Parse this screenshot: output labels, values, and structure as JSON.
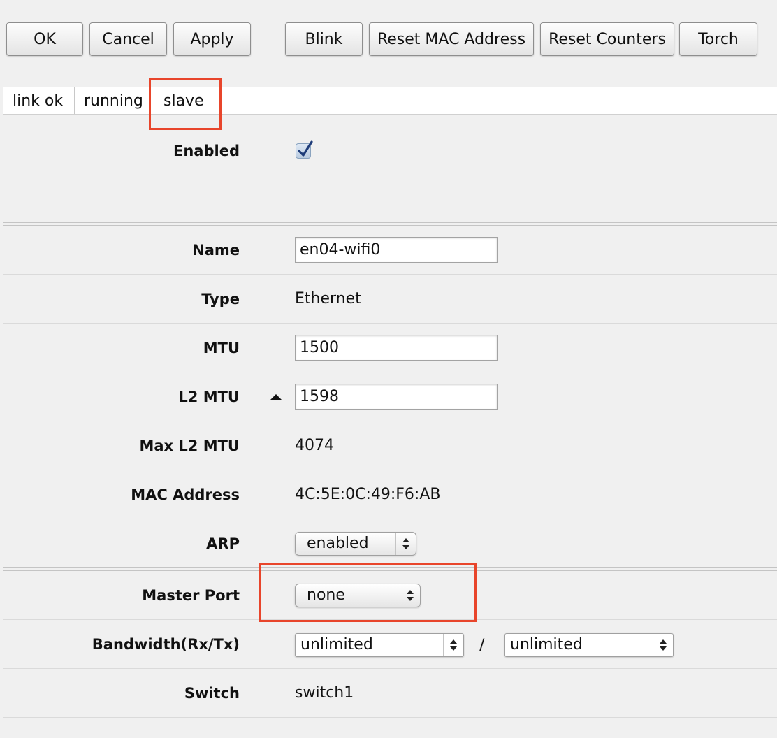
{
  "toolbar": {
    "ok": "OK",
    "cancel": "Cancel",
    "apply": "Apply",
    "blink": "Blink",
    "reset_mac": "Reset MAC Address",
    "reset_counters": "Reset Counters",
    "torch": "Torch"
  },
  "status_tabs": [
    "link ok",
    "running",
    "slave"
  ],
  "form": {
    "enabled": {
      "label": "Enabled",
      "checked": true
    },
    "name": {
      "label": "Name",
      "value": "en04-wifi0"
    },
    "type": {
      "label": "Type",
      "value": "Ethernet"
    },
    "mtu": {
      "label": "MTU",
      "value": "1500"
    },
    "l2mtu": {
      "label": "L2 MTU",
      "value": "1598"
    },
    "max_l2mtu": {
      "label": "Max L2 MTU",
      "value": "4074"
    },
    "mac": {
      "label": "MAC Address",
      "value": "4C:5E:0C:49:F6:AB"
    },
    "arp": {
      "label": "ARP",
      "value": "enabled"
    },
    "master_port": {
      "label": "Master Port",
      "value": "none"
    },
    "bandwidth": {
      "label": "Bandwidth(Rx/Tx)",
      "rx": "unlimited",
      "separator": "/",
      "tx": "unlimited"
    },
    "switch": {
      "label": "Switch",
      "value": "switch1"
    }
  },
  "colors": {
    "highlight": "#e8452b",
    "background": "#f0f0f0",
    "checkbox_check": "#1f3d7a"
  },
  "icons": {
    "checkmark": "checkmark-icon",
    "expand": "triangle-up-icon",
    "select_arrows": "updown-arrows-icon"
  }
}
